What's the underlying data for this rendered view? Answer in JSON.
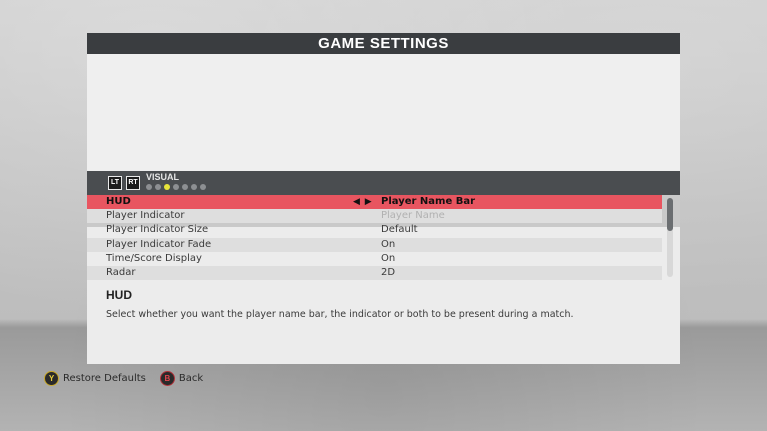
{
  "title": "GAME SETTINGS",
  "tabs": {
    "left_bumper": "LT",
    "right_bumper": "RT",
    "section": "VISUAL",
    "page_count": 7,
    "active_page": 3
  },
  "settings": [
    {
      "name": "HUD",
      "value": "Player Name Bar",
      "selected": true,
      "disabled": false
    },
    {
      "name": "Player Indicator",
      "value": "Player Name",
      "selected": false,
      "disabled": true
    },
    {
      "name": "Player Indicator Size",
      "value": "Default",
      "selected": false,
      "disabled": false
    },
    {
      "name": "Player Indicator Fade",
      "value": "On",
      "selected": false,
      "disabled": false
    },
    {
      "name": "Time/Score Display",
      "value": "On",
      "selected": false,
      "disabled": false
    },
    {
      "name": "Radar",
      "value": "2D",
      "selected": false,
      "disabled": false
    }
  ],
  "selector_arrows": "◀ ▶",
  "description": {
    "title": "HUD",
    "text": "Select whether you want the player name bar, the indicator or both to be present during a match."
  },
  "footer": {
    "restore": {
      "button": "Y",
      "label": "Restore Defaults"
    },
    "back": {
      "button": "B",
      "label": "Back"
    }
  },
  "colors": {
    "title_bar": "#3a3d40",
    "selected_row": "#e85560",
    "active_dot": "#e7e43a"
  },
  "scroll": {
    "position": 0,
    "visible_fraction": 0.42
  }
}
